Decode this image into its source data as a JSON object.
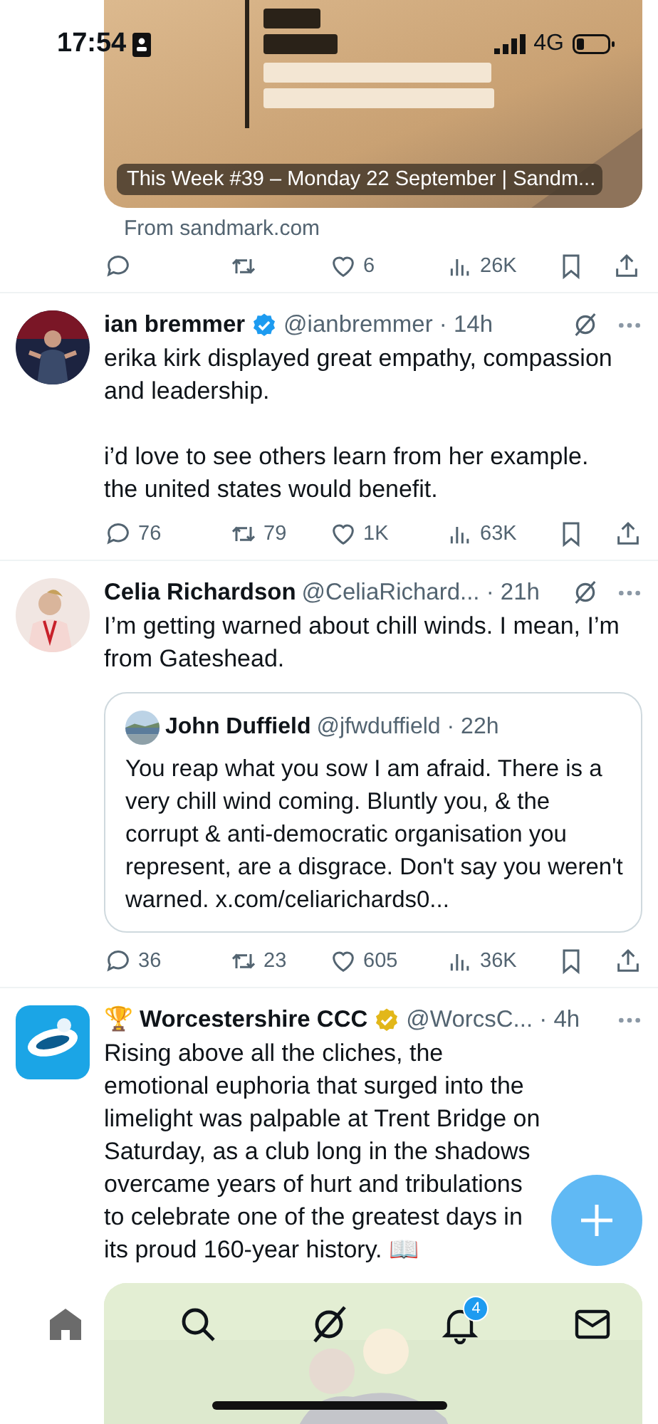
{
  "status_bar": {
    "time": "17:54",
    "network": "4G"
  },
  "feed": [
    {
      "kind": "card_tail",
      "card": {
        "kind": "picture",
        "caption": "This Week #39 – Monday 22 September | Sandm..."
      },
      "source": "From sandmark.com",
      "stats": {
        "likes": "6",
        "views": "26K"
      }
    },
    {
      "kind": "post",
      "avatar": {
        "kind": "figure"
      },
      "author": {
        "name": "ian bremmer",
        "verified": true,
        "color": "#1d9bf0",
        "meta": "@ianbremmer · 14h"
      },
      "grok": true,
      "text": "erika kirk displayed great empathy, compassion and leadership.\n\ni’d love to see others learn from her example.\nthe united states would benefit.",
      "stats": {
        "replies": "76",
        "reposts": "79",
        "likes": "1K",
        "views": "63K"
      }
    },
    {
      "kind": "post",
      "avatar": {
        "kind": "portrait"
      },
      "author": {
        "name": "Celia Richardson",
        "verified": false,
        "meta": "@CeliaRichard... · 21h"
      },
      "grok": true,
      "text": "I’m getting warned about chill winds. I mean, I’m from Gateshead.",
      "quote": {
        "avatar": {
          "kind": "landscape"
        },
        "name": "John Duffield",
        "meta": "@jfwduffield · 22h",
        "text": "You reap what you sow I am afraid. There is a very chill wind coming. Bluntly you, & the corrupt & anti-democratic organisation you represent, are a disgrace. Don't say you weren't warned. x.com/celiarichards0..."
      },
      "stats": {
        "replies": "36",
        "reposts": "23",
        "likes": "605",
        "views": "36K"
      }
    },
    {
      "kind": "post",
      "avatar": {
        "kind": "logo"
      },
      "author": {
        "prefix": "🏆",
        "name": "Worcestershire CCC",
        "verified": true,
        "color": "#e2b719",
        "meta": "@WorcsC... · 4h"
      },
      "grok": false,
      "text": "Rising above all the cliches, the emotional euphoria that surged into the limelight was palpable at Trent Bridge on Saturday, as a club long in the shadows overcame years of hurt and tribulations to celebrate one of the greatest days in its proud 160-year history. 📖"
    }
  ],
  "nav": [
    {
      "kind": "home",
      "selected": true
    },
    {
      "kind": "search",
      "selected": false
    },
    {
      "kind": "grok",
      "selected": false
    },
    {
      "kind": "bell",
      "selected": false,
      "badge": "4"
    },
    {
      "kind": "mail",
      "selected": false
    }
  ]
}
